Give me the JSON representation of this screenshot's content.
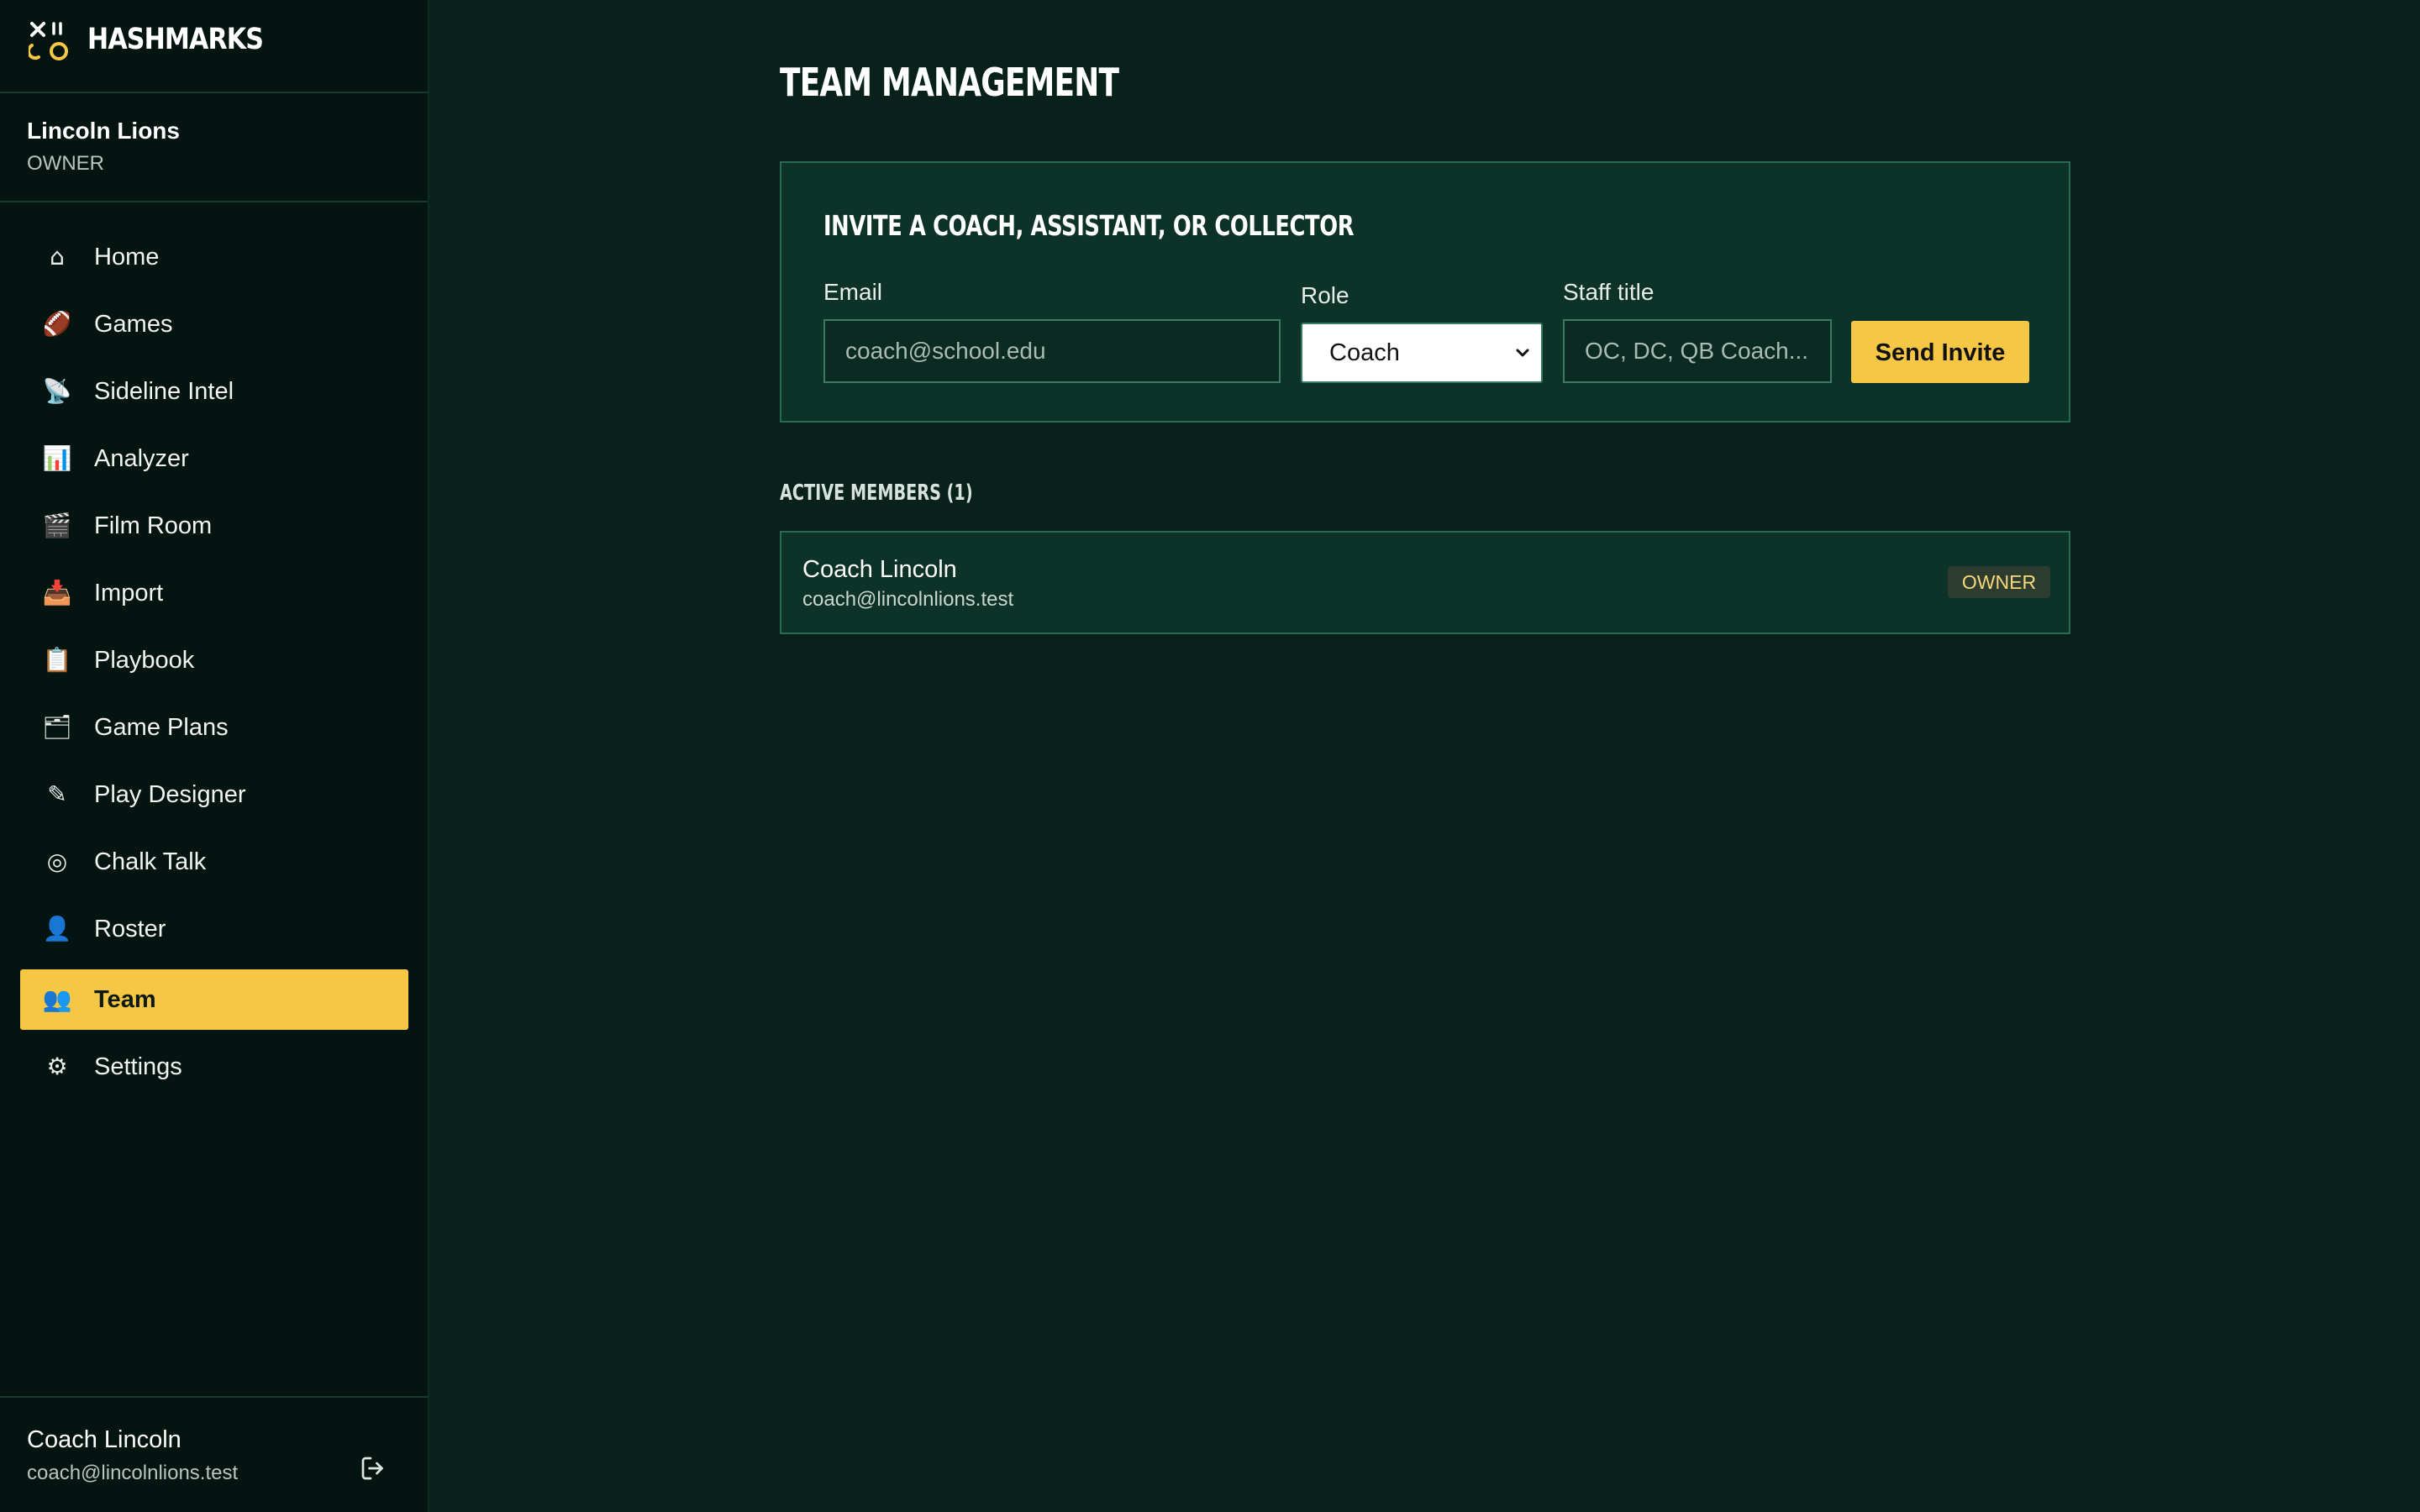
{
  "brand": {
    "name": "HASHMARKS"
  },
  "team": {
    "name": "Lincoln Lions",
    "role": "OWNER"
  },
  "nav": {
    "items": [
      {
        "icon": "⌂",
        "label": "Home"
      },
      {
        "icon": "🏈",
        "label": "Games"
      },
      {
        "icon": "📡",
        "label": "Sideline Intel"
      },
      {
        "icon": "📊",
        "label": "Analyzer"
      },
      {
        "icon": "🎬",
        "label": "Film Room"
      },
      {
        "icon": "📥",
        "label": "Import"
      },
      {
        "icon": "📋",
        "label": "Playbook"
      },
      {
        "icon": "🗂",
        "label": "Game Plans"
      },
      {
        "icon": "✎",
        "label": "Play Designer"
      },
      {
        "icon": "◎",
        "label": "Chalk Talk"
      },
      {
        "icon": "👤",
        "label": "Roster"
      },
      {
        "icon": "👥",
        "label": "Team"
      },
      {
        "icon": "⚙",
        "label": "Settings"
      }
    ],
    "active": "Team"
  },
  "user": {
    "name": "Coach Lincoln",
    "email": "coach@lincolnlions.test"
  },
  "page": {
    "title": "TEAM MANAGEMENT"
  },
  "invite": {
    "heading": "INVITE A COACH, ASSISTANT, OR COLLECTOR",
    "email_label": "Email",
    "email_placeholder": "coach@school.edu",
    "role_label": "Role",
    "role_value": "Coach",
    "title_label": "Staff title",
    "title_placeholder": "OC, DC, QB Coach...",
    "send_label": "Send Invite"
  },
  "members": {
    "heading": "ACTIVE MEMBERS (1)",
    "list": [
      {
        "name": "Coach Lincoln",
        "email": "coach@lincolnlions.test",
        "badge": "OWNER"
      }
    ]
  },
  "colors": {
    "accent": "#f6c744",
    "sidebar_bg": "#041511",
    "main_bg": "#08211a",
    "card_bg": "#0d3227",
    "card_border": "#2a6a55"
  }
}
